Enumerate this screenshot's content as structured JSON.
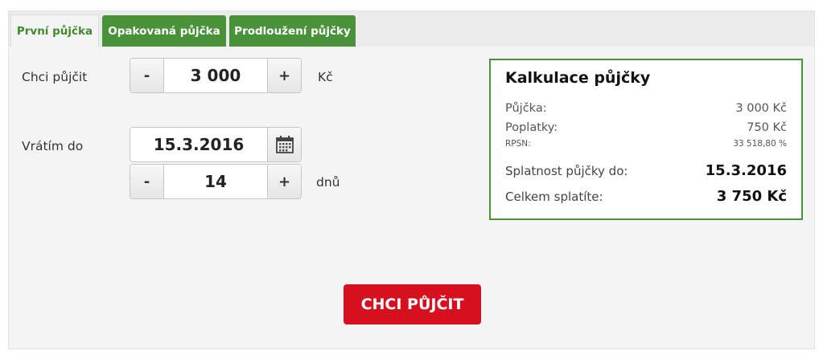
{
  "tabs": [
    {
      "label": "První půjčka",
      "active": true
    },
    {
      "label": "Opakovaná půjčka",
      "active": false
    },
    {
      "label": "Prodloužení půjčky",
      "active": false
    }
  ],
  "amount": {
    "label": "Chci půjčit",
    "minus": "-",
    "value": "3 000",
    "plus": "+",
    "unit": "Kč"
  },
  "repay": {
    "label": "Vrátím do",
    "date": "15.3.2016",
    "days": {
      "minus": "-",
      "value": "14",
      "plus": "+",
      "unit": "dnů"
    }
  },
  "calculation": {
    "title": "Kalkulace půjčky",
    "loan_label": "Půjčka:",
    "loan_value": "3 000 Kč",
    "fees_label": "Poplatky:",
    "fees_value": "750 Kč",
    "rpsn_label": "RPSN:",
    "rpsn_value": "33 518,80 %",
    "due_label": "Splatnost půjčky do:",
    "due_value": "15.3.2016",
    "total_label": "Celkem splatíte:",
    "total_value": "3 750 Kč"
  },
  "cta": {
    "label": "CHCI PŮJČIT"
  },
  "colors": {
    "brand_green": "#4a9239",
    "cta_red": "#d7101f"
  }
}
